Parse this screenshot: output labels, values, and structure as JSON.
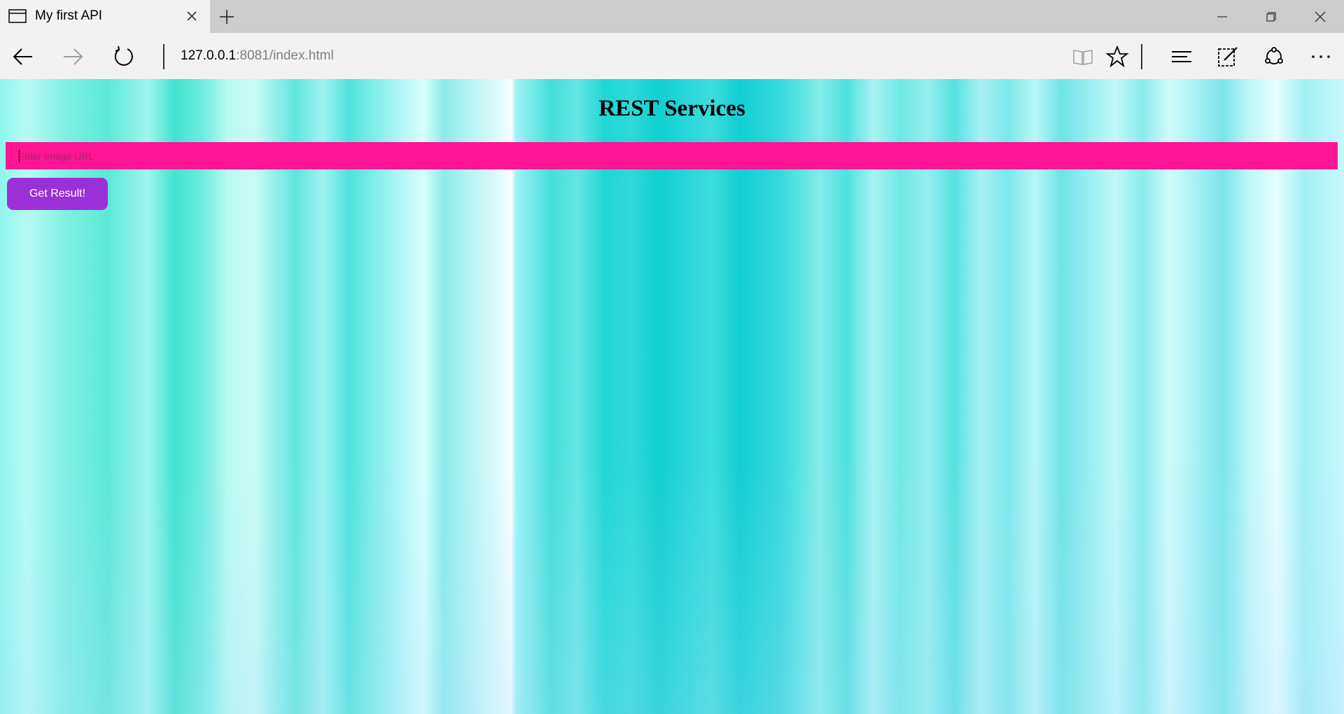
{
  "browser": {
    "tab_title": "My first API",
    "address_host": "127.0.0.1",
    "address_rest": ":8081/index.html"
  },
  "page": {
    "title": "REST Services",
    "input_placeholder": "Enter Image URL",
    "button_label": "Get Result!"
  },
  "colors": {
    "input_background": "#ff1493",
    "button_background": "#9b30d9",
    "page_background_theme": "cyan-striped"
  }
}
